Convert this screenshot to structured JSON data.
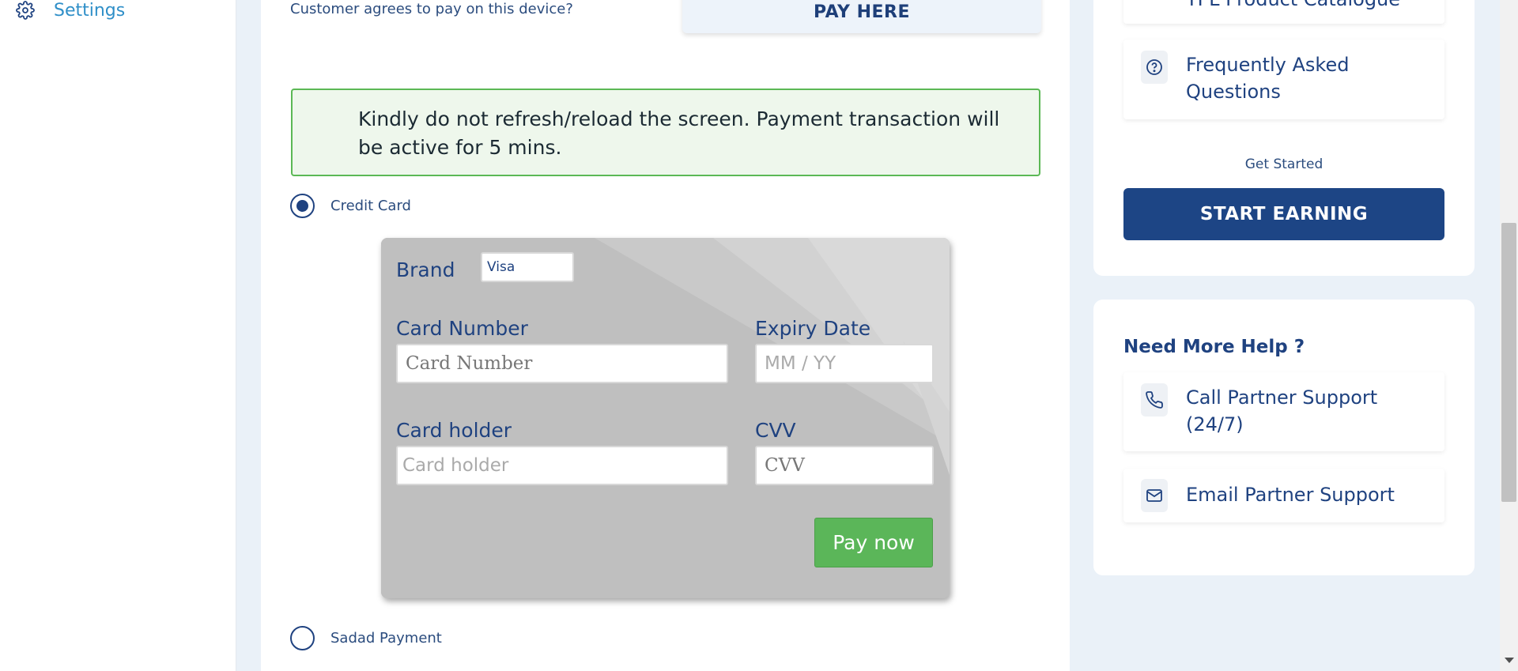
{
  "sidebar": {
    "settings_label": "Settings",
    "settings_icon": "gear-icon"
  },
  "main": {
    "agree_text": "Customer agrees to pay on this device?",
    "pay_here_label": "PAY HERE",
    "notice_text": "Kindly do not refresh/reload the screen. Payment transaction will be active for 5 mins.",
    "payment_options": [
      {
        "label": "Credit Card",
        "selected": true
      },
      {
        "label": "Sadad Payment",
        "selected": false
      }
    ],
    "card_form": {
      "brand_label": "Brand",
      "brand_value": "Visa",
      "card_number_label": "Card Number",
      "card_number_placeholder": "Card Number",
      "expiry_label": "Expiry Date",
      "expiry_placeholder": "MM / YY",
      "holder_label": "Card holder",
      "holder_placeholder": "Card holder",
      "cvv_label": "CVV",
      "cvv_placeholder": "CVV",
      "pay_now_label": "Pay now"
    }
  },
  "right": {
    "catalogue_label": "TPL Product Catalogue",
    "faq_label": "Frequently Asked Questions",
    "faq_icon": "question-icon",
    "get_started": "Get Started",
    "start_earning": "START EARNING",
    "help_title": "Need More Help ?",
    "call_support": "Call Partner Support (24/7)",
    "call_icon": "phone-icon",
    "email_support": "Email Partner Support",
    "email_icon": "mail-icon"
  },
  "colors": {
    "primary": "#1d4585",
    "success": "#5bb659",
    "notice_bg": "#eef7ec",
    "link": "#2f8fc8"
  }
}
